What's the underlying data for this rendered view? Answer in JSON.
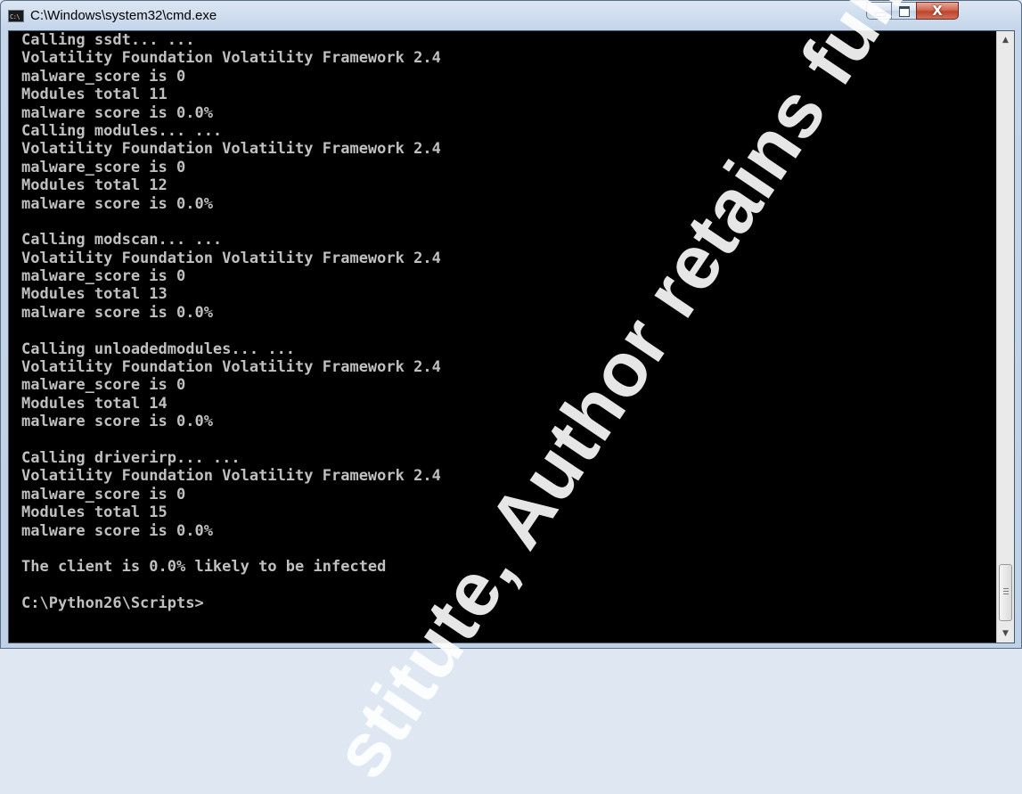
{
  "window": {
    "title": "C:\\Windows\\system32\\cmd.exe",
    "app_icon_text": "C:\\",
    "close_symbol": "X"
  },
  "console": {
    "lines": [
      "Calling ssdt... ...",
      "Volatility Foundation Volatility Framework 2.4",
      "malware_score is 0",
      "Modules total 11",
      "malware score is 0.0%",
      "Calling modules... ...",
      "Volatility Foundation Volatility Framework 2.4",
      "malware_score is 0",
      "Modules total 12",
      "malware score is 0.0%",
      "",
      "Calling modscan... ...",
      "Volatility Foundation Volatility Framework 2.4",
      "malware_score is 0",
      "Modules total 13",
      "malware score is 0.0%",
      "",
      "Calling unloadedmodules... ...",
      "Volatility Foundation Volatility Framework 2.4",
      "malware_score is 0",
      "Modules total 14",
      "malware score is 0.0%",
      "",
      "Calling driverirp... ...",
      "Volatility Foundation Volatility Framework 2.4",
      "malware_score is 0",
      "Modules total 15",
      "malware score is 0.0%",
      "",
      "The client is 0.0% likely to be infected",
      "",
      "C:\\Python26\\Scripts>"
    ]
  },
  "scrollbar": {
    "up_arrow": "▲",
    "down_arrow": "▼"
  },
  "watermark": {
    "text": "stitute, Author retains full"
  },
  "colors": {
    "console_bg": "#000000",
    "console_fg": "#c0c0c0",
    "close_button": "#c0432c"
  }
}
